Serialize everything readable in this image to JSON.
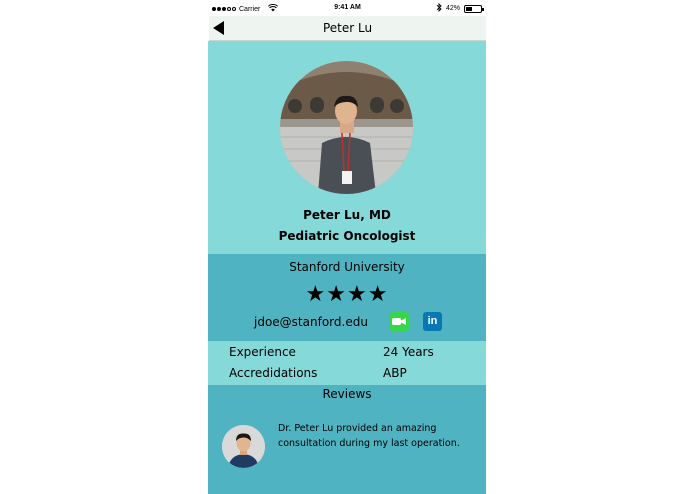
{
  "status_bar": {
    "carrier": "Carrier",
    "time": "9:41 AM",
    "battery": "42%",
    "battery_level": 0.42
  },
  "nav": {
    "title": "Peter Lu",
    "back_icon": "back-arrow-icon"
  },
  "profile": {
    "name": "Peter Lu, MD",
    "specialty": "Pediatric Oncologist",
    "university": "Stanford University",
    "rating_stars": "★★★★",
    "rating": 4,
    "email": "jdoe@stanford.edu",
    "facetime_icon": "facetime-icon",
    "linkedin_icon": "linkedin-icon",
    "linkedin_label": "in"
  },
  "info": [
    {
      "label": "Experience",
      "value": "24 Years"
    },
    {
      "label": "Accredidations",
      "value": "ABP"
    }
  ],
  "reviews": {
    "heading": "Reviews",
    "items": [
      {
        "text": "Dr. Peter Lu provided an amazing consultation during my last operation."
      }
    ]
  },
  "colors": {
    "light_teal": "#86d9d9",
    "dark_teal": "#4fb3c1",
    "nav_bg": "#eef5f1",
    "facetime_green": "#35d64a",
    "linkedin_blue": "#0a77b5"
  }
}
